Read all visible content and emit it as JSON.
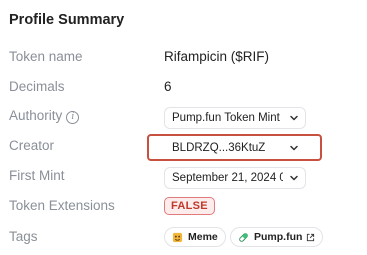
{
  "panel": {
    "title": "Profile Summary"
  },
  "rows": {
    "token_name": {
      "label": "Token name",
      "value": "Rifampicin ($RIF)"
    },
    "decimals": {
      "label": "Decimals",
      "value": "6"
    },
    "authority": {
      "label": "Authority",
      "value": "Pump.fun Token Mint ...",
      "icon": "info-icon"
    },
    "creator": {
      "label": "Creator",
      "value": "BLDRZQ...36KtuZ"
    },
    "first_mint": {
      "label": "First Mint",
      "value": "September 21, 2024 0..."
    },
    "token_extensions": {
      "label": "Token Extensions",
      "value": "FALSE"
    },
    "tags": {
      "label": "Tags",
      "items": [
        {
          "label": "Meme",
          "icon": "meme-icon"
        },
        {
          "label": "Pump.fun",
          "icon": "pill-icon",
          "trailing_icon": "external-link-icon"
        }
      ]
    }
  },
  "colors": {
    "highlight_border": "#c8503e",
    "false_badge_text": "#c0392b",
    "false_badge_bg": "#fdecec",
    "label_gray": "#8a8f98"
  }
}
